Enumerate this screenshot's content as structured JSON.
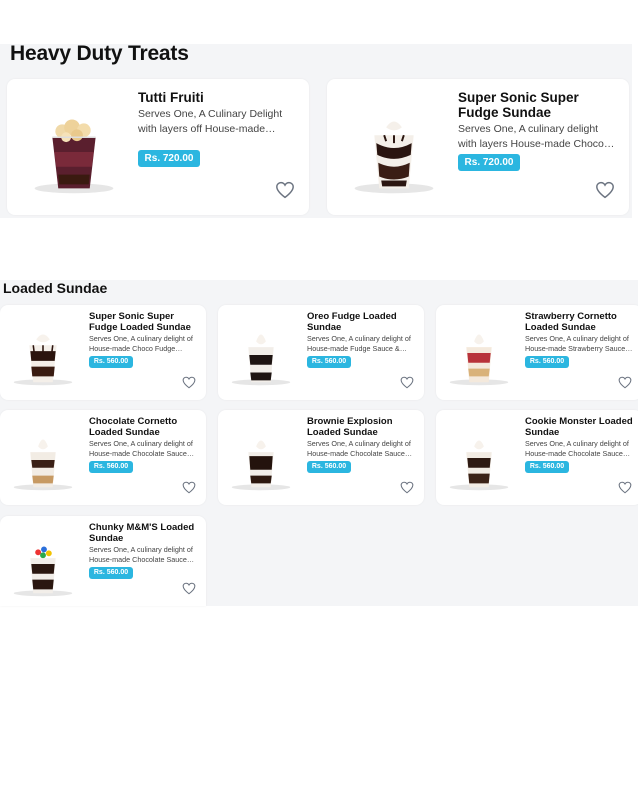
{
  "sections": [
    {
      "title": "Heavy Duty Treats",
      "items": [
        {
          "name": "Tutti Fruiti",
          "desc": "Serves One, A Culinary Delight with layers off House-made…",
          "price": "Rs. 720.00"
        },
        {
          "name": "Super Sonic Super Fudge Sundae",
          "desc": "Serves One, A culinary delight with layers House-made Choco…",
          "price": "Rs. 720.00"
        }
      ]
    },
    {
      "title": "Loaded Sundae",
      "items": [
        {
          "name": "Super Sonic Super Fudge Loaded Sundae",
          "desc": "Serves One, A culinary delight of House-made Choco Fudge…",
          "price": "Rs. 560.00"
        },
        {
          "name": "Oreo Fudge Loaded Sundae",
          "desc": "Serves One, A culinary delight of House-made Fudge Sauce &…",
          "price": "Rs. 560.00"
        },
        {
          "name": "Strawberry Cornetto Loaded Sundae",
          "desc": "Serves One, A culinary delight of House-made Strawberry Sauce…",
          "price": "Rs. 560.00"
        },
        {
          "name": "Chocolate Cornetto Loaded Sundae",
          "desc": "Serves One, A culinary delight of House-made Chocolate Sauce…",
          "price": "Rs. 560.00"
        },
        {
          "name": "Brownie Explosion Loaded Sundae",
          "desc": "Serves One, A culinary delight of House-made Chocolate Sauce…",
          "price": "Rs. 560.00"
        },
        {
          "name": "Cookie Monster Loaded Sundae",
          "desc": "Serves One, A culinary delight of House-made Chocolate Sauce…",
          "price": "Rs. 560.00"
        },
        {
          "name": "Chunky M&M'S Loaded Sundae",
          "desc": "Serves One, A culinary delight of House-made Chocolate Sauce…",
          "price": "Rs. 560.00"
        }
      ]
    }
  ],
  "icons": {
    "favorite": "heart-outline-icon"
  },
  "colors": {
    "price_badge": "#2bb6e0",
    "section_bg": "#f4f5f7",
    "card_bg": "#ffffff"
  }
}
